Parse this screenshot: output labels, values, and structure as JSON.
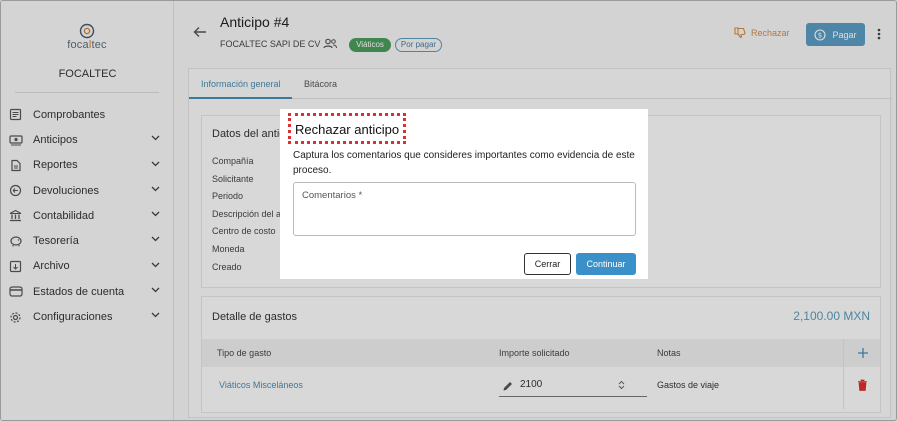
{
  "brand": {
    "logo_prefix": "foca",
    "logo_accent": "l",
    "logo_suffix": "tec",
    "company": "FOCALTEC"
  },
  "sidebar": {
    "items": [
      {
        "label": "Comprobantes",
        "icon": "receipt-icon",
        "expandable": false
      },
      {
        "label": "Anticipos",
        "icon": "cash-icon",
        "expandable": true
      },
      {
        "label": "Reportes",
        "icon": "report-icon",
        "expandable": true
      },
      {
        "label": "Devoluciones",
        "icon": "return-icon",
        "expandable": true
      },
      {
        "label": "Contabilidad",
        "icon": "bank-icon",
        "expandable": true
      },
      {
        "label": "Tesorería",
        "icon": "piggy-bank-icon",
        "expandable": true
      },
      {
        "label": "Archivo",
        "icon": "archive-icon",
        "expandable": true
      },
      {
        "label": "Estados de cuenta",
        "icon": "card-icon",
        "expandable": true
      },
      {
        "label": "Configuraciones",
        "icon": "gear-icon",
        "expandable": true
      }
    ]
  },
  "header": {
    "title": "Anticipo #4",
    "company": "FOCALTEC SAPI DE CV",
    "badge_type": "Viáticos",
    "badge_status": "Por pagar",
    "reject_label": "Rechazar",
    "pay_label": "Pagar"
  },
  "tabs": [
    "Información general",
    "Bitácora"
  ],
  "general": {
    "title": "Datos del anticipo",
    "fields": [
      "Compañía",
      "Solicitante",
      "Periodo",
      "Descripción del anticipo",
      "Centro de costo",
      "Moneda",
      "Creado"
    ]
  },
  "expenses": {
    "title": "Detalle de gastos",
    "total": "2,100.00 MXN",
    "columns": [
      "Tipo de gasto",
      "Importe solicitado",
      "Notas"
    ],
    "rows": [
      {
        "type": "Viáticos Misceláneos",
        "amount": "2100",
        "notes": "Gastos de viaje"
      }
    ]
  },
  "dialog": {
    "title": "Rechazar anticipo",
    "message": "Captura los comentarios que consideres importantes como evidencia de este proceso.",
    "comment_label": "Comentarios *",
    "close_label": "Cerrar",
    "continue_label": "Continuar"
  },
  "colors": {
    "primary": "#3a90c8",
    "reject": "#d08a40",
    "badge_green": "#4a9a5a",
    "danger": "#d93030"
  }
}
